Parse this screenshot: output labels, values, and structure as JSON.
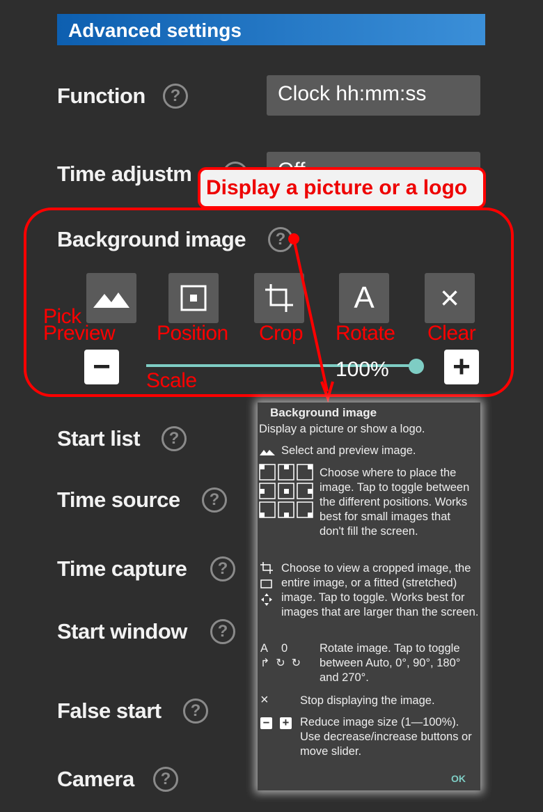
{
  "header": {
    "title": "Advanced settings",
    "color": "#1a6fc0"
  },
  "settings": [
    {
      "label": "Function",
      "value": "Clock hh:mm:ss"
    },
    {
      "label": "Time adjustm",
      "value": "Off"
    },
    {
      "label": "Background image"
    },
    {
      "label": "Start list"
    },
    {
      "label": "Time source"
    },
    {
      "label": "Time capture"
    },
    {
      "label": "Start window"
    },
    {
      "label": "False start"
    },
    {
      "label": "Camera"
    }
  ],
  "help_glyph": "?",
  "image_buttons": [
    {
      "icon": "image-icon",
      "annotation_1": "Pick",
      "annotation_2": "Preview"
    },
    {
      "icon": "position-icon",
      "annotation": "Position"
    },
    {
      "icon": "crop-icon",
      "annotation": "Crop"
    },
    {
      "icon": "rotate-auto-icon",
      "glyph": "A",
      "annotation": "Rotate"
    },
    {
      "icon": "close-icon",
      "glyph": "×",
      "annotation": "Clear"
    }
  ],
  "scale": {
    "value_label": "100%",
    "value_percent": 100,
    "annotation": "Scale",
    "minus": "−",
    "plus": "+",
    "accent": "#7ecdc4"
  },
  "callout": {
    "text": "Display a picture or a logo",
    "color": "#ff0000"
  },
  "dialog": {
    "title": "Background image",
    "subtitle": "Display a picture or show a logo.",
    "preview": "Select and preview image.",
    "position": "Choose where to place the image. Tap to toggle between the different positions. Works best for small images that don't fill the screen.",
    "crop": "Choose to view a cropped image, the entire image, or a fitted (stretched) image. Tap to toggle. Works best for images that are larger than the screen.",
    "rotate_glyphs": [
      "A",
      "0"
    ],
    "rotate": "Rotate image. Tap to toggle between Auto, 0°, 90°, 180° and 270°.",
    "clear": "Stop displaying the image.",
    "scale": "Reduce image size (1—100%). Use decrease/increase buttons or move slider.",
    "ok": "OK"
  }
}
